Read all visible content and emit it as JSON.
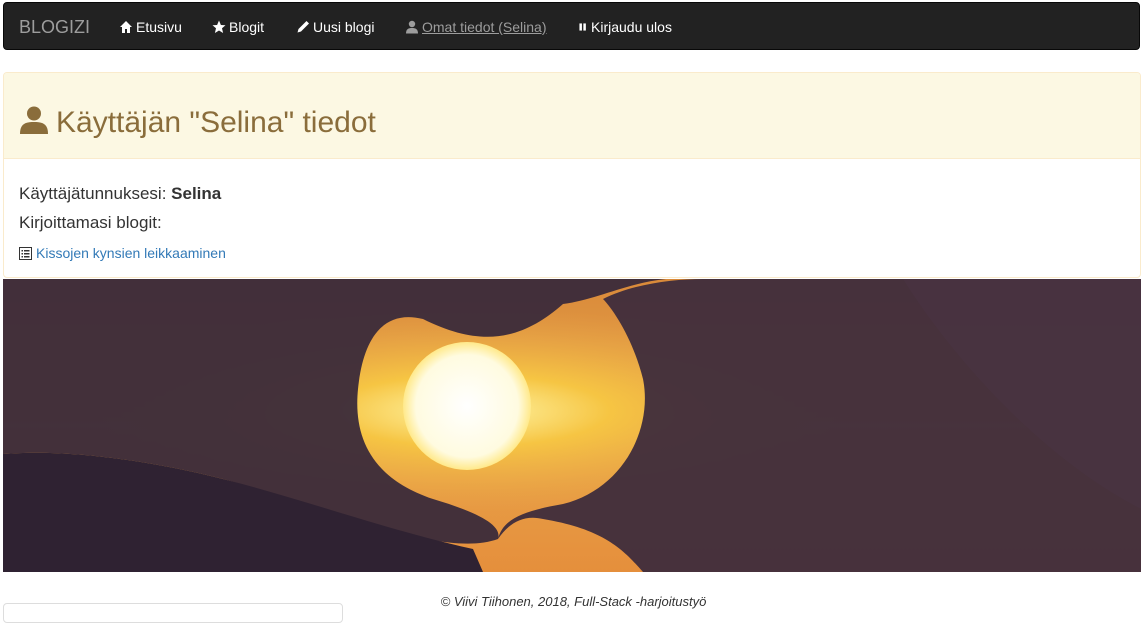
{
  "navbar": {
    "brand": "BLOGIZI",
    "items": [
      {
        "label": "Etusivu",
        "icon": "home-icon"
      },
      {
        "label": "Blogit",
        "icon": "star-icon"
      },
      {
        "label": "Uusi blogi",
        "icon": "pencil-icon"
      },
      {
        "label": "Omat tiedot (Selina)",
        "icon": "user-icon",
        "active": true
      },
      {
        "label": "Kirjaudu ulos",
        "icon": "pause-icon"
      }
    ]
  },
  "profile": {
    "title": "Käyttäjän \"Selina\" tiedot",
    "username_label": "Käyttäjätunnuksesi:",
    "username": "Selina",
    "blogs_label": "Kirjoittamasi blogit:",
    "blogs": [
      {
        "title": "Kissojen kynsien leikkaaminen",
        "icon": "list-alt-icon"
      }
    ]
  },
  "footer": {
    "text": "© Viivi Tiihonen, 2018, Full-Stack -harjoitustyö"
  },
  "colors": {
    "navbar_bg": "#222222",
    "panel_heading_bg": "#fcf8e3",
    "panel_heading_text": "#8a6d3b",
    "link": "#337ab7"
  }
}
